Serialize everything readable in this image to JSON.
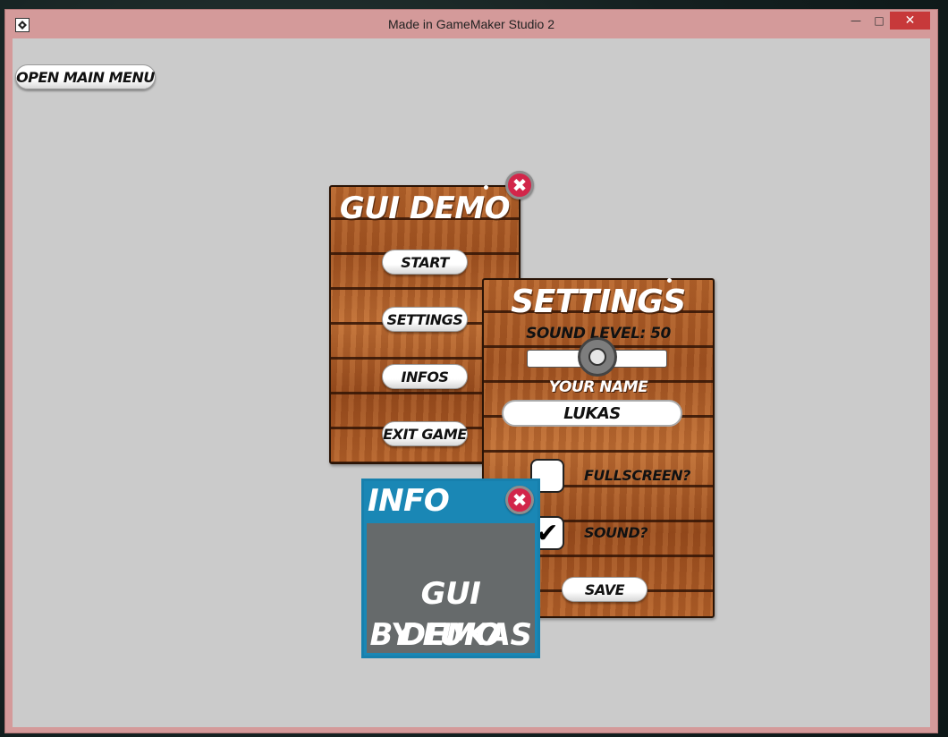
{
  "window": {
    "title": "Made in GameMaker Studio 2",
    "minimize_glyph": "—",
    "maximize_glyph": "□",
    "close_glyph": "✕"
  },
  "toolbar": {
    "open_main_menu_label": "OPEN MAIN MENU"
  },
  "main_menu": {
    "title": "GUI DEMO",
    "close_glyph": "✖",
    "buttons": {
      "start": "START",
      "settings": "SETTINGS",
      "infos": "INFOS",
      "exit_game": "EXIT GAME"
    }
  },
  "settings": {
    "title": "SETTINGS",
    "sound_level_label": "SOUND LEVEL: 50",
    "sound_level_value": 50,
    "your_name_label": "YOUR NAME",
    "name_value": "LUKAS",
    "fullscreen_label": "FULLSCREEN?",
    "fullscreen_checked": false,
    "sound_label": "SOUND?",
    "sound_checked": true,
    "check_glyph": "✔",
    "save_label": "SAVE"
  },
  "info": {
    "title": "INFO",
    "close_glyph": "✖",
    "line1": "GUI DEMO",
    "line2": "BY LUKAS"
  },
  "colors": {
    "client_bg": "#cbcbcb",
    "window_frame": "#d49a9a",
    "info_blue": "#1a87b5",
    "info_body": "#666a6b",
    "close_red": "#d2264a"
  }
}
